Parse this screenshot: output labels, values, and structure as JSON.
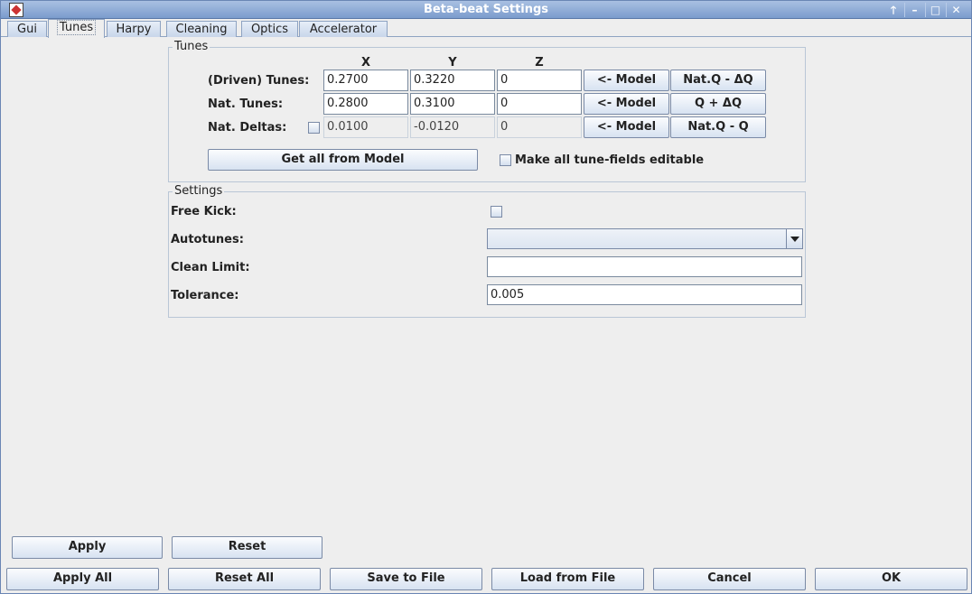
{
  "window": {
    "title": "Beta-beat Settings",
    "controls": [
      "🡑",
      "–",
      "□",
      "✕"
    ]
  },
  "tabs": [
    "Gui",
    "Tunes",
    "Harpy",
    "Cleaning",
    "Optics",
    "Accelerator"
  ],
  "active_tab": "Tunes",
  "tunes": {
    "legend": "Tunes",
    "col_x": "X",
    "col_y": "Y",
    "col_z": "Z",
    "driven_label": "(Driven) Tunes:",
    "driven_x": "0.2700",
    "driven_y": "0.3220",
    "driven_z": "0",
    "nat_label": "Nat. Tunes:",
    "nat_x": "0.2800",
    "nat_y": "0.3100",
    "nat_z": "0",
    "deltas_label": "Nat. Deltas:",
    "deltas_x": "0.0100",
    "deltas_y": "-0.0120",
    "deltas_z": "0",
    "model_btn": "<- Model",
    "row1_btn": "Nat.Q - ΔQ",
    "row2_btn": "Q + ΔQ",
    "row3_btn": "Nat.Q - Q",
    "get_all": "Get all from Model",
    "editable_label": "Make all tune-fields editable"
  },
  "settings": {
    "legend": "Settings",
    "free_kick": "Free Kick:",
    "autotunes": "Autotunes:",
    "autotunes_value": "",
    "clean_limit": "Clean Limit:",
    "clean_limit_value": "",
    "tolerance": "Tolerance:",
    "tolerance_value": "0.005"
  },
  "buttons": {
    "apply": "Apply",
    "reset": "Reset",
    "apply_all": "Apply All",
    "reset_all": "Reset All",
    "save": "Save to File",
    "load": "Load from File",
    "cancel": "Cancel",
    "ok": "OK"
  }
}
